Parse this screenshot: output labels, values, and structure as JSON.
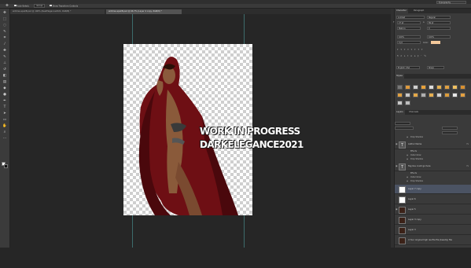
{
  "menubar": {
    "workspace": "Typography"
  },
  "options_bar": {
    "auto_select_label": "Auto-Select:",
    "auto_select_value": "Group",
    "transform_controls_label": "Show Transform Controls"
  },
  "document_tabs": [
    {
      "label": "witches.spellB.psd @ 100% (RealElegance2021, RGB/8) *",
      "active": false
    },
    {
      "label": "witches.spellB.psd @ 66.7% (Layer 4 copy, RGB/8) *",
      "active": true
    }
  ],
  "canvas": {
    "overlay_line1": "WORK IN PROGRESS",
    "overlay_line2": "DARKELEGANCE2021"
  },
  "character_panel": {
    "tabs": [
      "Character",
      "Paragraph"
    ],
    "font_family": "Lombat",
    "font_style": "Regular",
    "font_size": "27 pt",
    "leading": "89 pt",
    "kerning": "Metrics",
    "tracking": "0",
    "vscale": "100%",
    "hscale": "100%",
    "baseline": "0 pt",
    "color_label": "Color:",
    "color": "#f3c89a",
    "language": "English: USA",
    "antialias": "Sharp"
  },
  "styles_panel": {
    "title": "Styles"
  },
  "layers_panel": {
    "tabs": [
      "Layers",
      "Channels"
    ],
    "rows": [
      {
        "type": "sub",
        "name": "Drop Shadow"
      },
      {
        "type": "layer",
        "name": "Author Name",
        "thumb": "T",
        "fx": "fx"
      },
      {
        "type": "sub",
        "name": "Effects"
      },
      {
        "type": "sub",
        "name": "Outer Glow"
      },
      {
        "type": "sub",
        "name": "Drop Shadow"
      },
      {
        "type": "layer",
        "name": "Tag line could go here",
        "thumb": "T",
        "fx": "fx"
      },
      {
        "type": "sub",
        "name": "Effects"
      },
      {
        "type": "sub",
        "name": "Outer Glow"
      },
      {
        "type": "sub",
        "name": "Drop Shadow"
      },
      {
        "type": "layer",
        "name": "Layer 7 copy",
        "thumb": "",
        "selected": true
      },
      {
        "type": "layer",
        "name": "Layer 6",
        "thumb": ""
      },
      {
        "type": "layer",
        "name": "Layer 5",
        "thumb": "dark"
      },
      {
        "type": "layer",
        "name": "Layer 3 copy",
        "thumb": "dark"
      },
      {
        "type": "layer",
        "name": "Layer 3",
        "thumb": "dark"
      },
      {
        "type": "layer",
        "name": "4 Your original high res file file (beauty) file",
        "thumb": "dark"
      }
    ]
  }
}
